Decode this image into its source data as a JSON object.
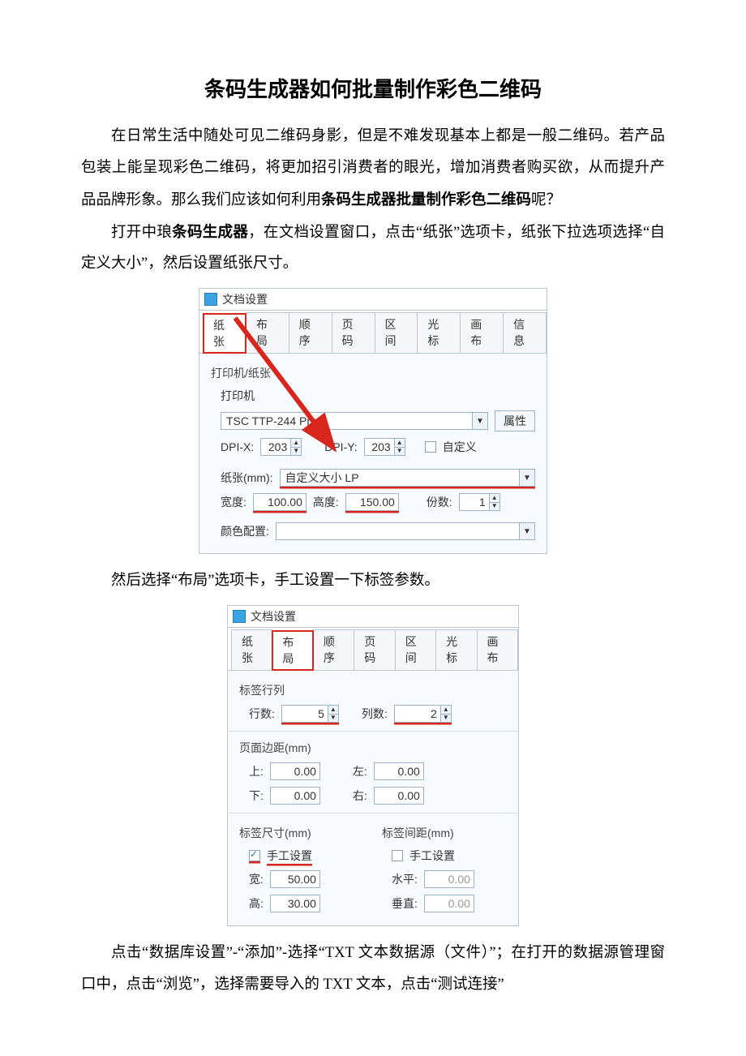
{
  "doc": {
    "title": "条码生成器如何批量制作彩色二维码",
    "p1a": "在日常生活中随处可见二维码身影，但是不难发现基本上都是一般二维码。若产品包装上能呈现彩色二维码，将更加招引消费者的眼光，增加消费者购买欲，从而提升产品品牌形象。那么我们应该如何利用",
    "p1b": "条码生成器批量制作彩色二维码",
    "p1c": "呢？",
    "p2a": "打开中琅",
    "p2b": "条码生成器",
    "p2c": "，在文档设置窗口，点击“纸张”选项卡，纸张下拉选项选择“自定义大小”，然后设置纸张尺寸。",
    "p3": "然后选择“布局”选项卡，手工设置一下标签参数。",
    "p4": "点击“数据库设置”-“添加”-选择“TXT 文本数据源（文件）”；在打开的数据源管理窗口中，点击“浏览”，选择需要导入的 TXT 文本，点击“测试连接”"
  },
  "dlg": {
    "title": "文档设置",
    "tabs": [
      "纸张",
      "布局",
      "顺序",
      "页码",
      "区间",
      "光标",
      "画布",
      "信息"
    ]
  },
  "s1": {
    "group_printer": "打印机/纸张",
    "printer_lbl": "打印机",
    "printer_val": "TSC TTP-244 Pro",
    "props_btn": "属性",
    "dpix_lbl": "DPI-X:",
    "dpix_val": "203",
    "dpiy_lbl": "DPI-Y:",
    "dpiy_val": "203",
    "custom_cb": "自定义",
    "paper_lbl": "纸张(mm):",
    "paper_val": "自定义大小 LP",
    "width_lbl": "宽度:",
    "width_val": "100.00",
    "height_lbl": "高度:",
    "height_val": "150.00",
    "copies_lbl": "份数:",
    "copies_val": "1",
    "color_lbl": "颜色配置:"
  },
  "s2": {
    "rows_group": "标签行列",
    "rows_lbl": "行数:",
    "rows_val": "5",
    "cols_lbl": "列数:",
    "cols_val": "2",
    "margin_group": "页面边距(mm)",
    "m_top_lbl": "上:",
    "m_top_val": "0.00",
    "m_left_lbl": "左:",
    "m_left_val": "0.00",
    "m_bottom_lbl": "下:",
    "m_bottom_val": "0.00",
    "m_right_lbl": "右:",
    "m_right_val": "0.00",
    "size_group": "标签尺寸(mm)",
    "gap_group": "标签间距(mm)",
    "manual_cb": "手工设置",
    "w_lbl": "宽:",
    "w_val": "50.00",
    "h_lbl": "高:",
    "h_val": "30.00",
    "hgap_lbl": "水平:",
    "hgap_val": "0.00",
    "vgap_lbl": "垂直:",
    "vgap_val": "0.00"
  }
}
